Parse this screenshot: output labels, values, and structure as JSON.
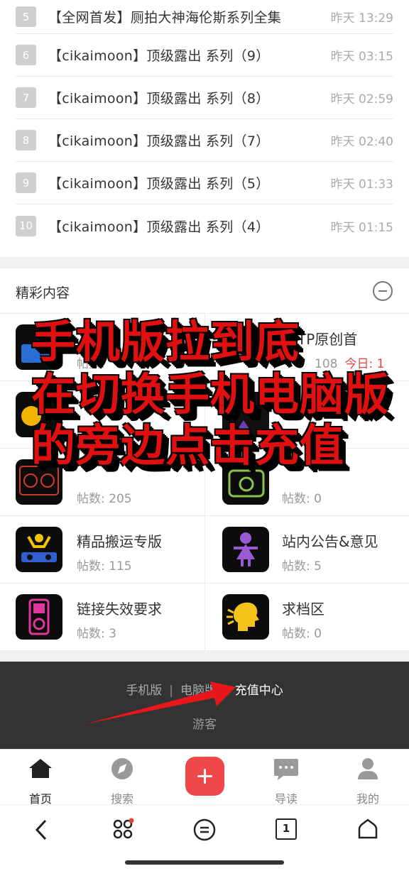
{
  "rank_list": [
    {
      "num": "5",
      "title": "【全网首发】厕拍大神海伦斯系列全集",
      "time": "昨天 13:29"
    },
    {
      "num": "6",
      "title": "【cikaimoon】顶级露出 系列（9）",
      "time": "昨天 03:15"
    },
    {
      "num": "7",
      "title": "【cikaimoon】顶级露出 系列（8）",
      "time": "昨天 02:59"
    },
    {
      "num": "8",
      "title": "【cikaimoon】顶级露出 系列（7）",
      "time": "昨天 02:40"
    },
    {
      "num": "9",
      "title": "【cikaimoon】顶级露出 系列（5）",
      "time": "昨天 01:33"
    },
    {
      "num": "10",
      "title": "【cikaimoon】顶级露出 系列（4）",
      "time": "昨天 01:15"
    }
  ],
  "section": {
    "title": "精彩内容",
    "collapse_icon": "minus-circle-icon"
  },
  "forums": [
    {
      "name": "",
      "stat": "帖数:",
      "today": "",
      "icon": "tv-icon"
    },
    {
      "name": "TP原创首",
      "stat": "108",
      "today": "今日: 1",
      "icon": "forum-icon"
    },
    {
      "name": "",
      "stat": "",
      "today": "",
      "icon": "moon-icon"
    },
    {
      "name": "",
      "stat": "",
      "today": "",
      "icon": "forum-icon"
    },
    {
      "name": "",
      "stat": "帖数: 205",
      "today": "",
      "icon": "dj-console-icon"
    },
    {
      "name": "",
      "stat": "帖数: 0",
      "today": "",
      "icon": "camera-icon"
    },
    {
      "name": "精品搬运专版",
      "stat": "帖数: 115",
      "today": "",
      "icon": "dj-icon"
    },
    {
      "name": "站内公告&意见",
      "stat": "帖数: 5",
      "today": "",
      "icon": "girl-icon"
    },
    {
      "name": "链接失效要求",
      "stat": "帖数: 3",
      "today": "",
      "icon": "ipod-icon"
    },
    {
      "name": "求档区",
      "stat": "帖数: 0",
      "today": "",
      "icon": "speaking-head-icon"
    }
  ],
  "footer": {
    "mobile_label": "手机版",
    "pc_label": "电脑版",
    "recharge_label": "充值中心",
    "guest_label": "游客",
    "divider": "|"
  },
  "tabbar": [
    {
      "label": "首页",
      "icon": "home-icon",
      "active": true
    },
    {
      "label": "搜索",
      "icon": "compass-icon",
      "active": false
    },
    {
      "label": "",
      "icon": "plus-icon",
      "active": false
    },
    {
      "label": "导读",
      "icon": "chat-icon",
      "active": false
    },
    {
      "label": "我的",
      "icon": "user-icon",
      "active": false
    }
  ],
  "system_nav": [
    "back-icon",
    "apps-icon",
    "menu-icon",
    "tabs-icon",
    "home-outline-icon"
  ],
  "system_nav_tab_count": "1",
  "overlay": {
    "line1": "手机版拉到底",
    "line2": "在切换手机电脑版",
    "line3": "的旁边点击充值"
  },
  "colors": {
    "accent": "#f0484a",
    "overlay_text": "#e01010",
    "footer_bg": "#333333"
  }
}
